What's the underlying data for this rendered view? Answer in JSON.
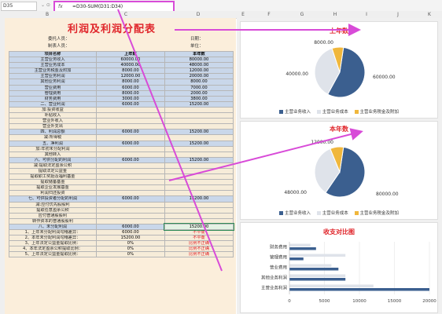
{
  "formula_bar": {
    "name_box": "D35",
    "fx_label": "fx",
    "formula": "=D30-SUM(D31:D34)"
  },
  "columns": [
    "B",
    "C",
    "D",
    "E",
    "F",
    "G",
    "H",
    "I",
    "J",
    "K"
  ],
  "sheet": {
    "title": "利润及利润分配表",
    "company_label": "委托人员：",
    "preparer_label": "制表人员：",
    "date_label": "日期：",
    "unit_label": "单位：",
    "rows": [
      {
        "item": "项目名称",
        "prev": "上年数",
        "curr": "本年数",
        "style": "hdr"
      },
      {
        "item": "主营业务收入",
        "prev": "60000.00",
        "curr": "80000.00",
        "style": "blue"
      },
      {
        "item": "主营业务成本",
        "prev": "40000.00",
        "curr": "48000.00",
        "style": "blue"
      },
      {
        "item": "主营业务税金及附加",
        "prev": "8000.00",
        "curr": "12000.00",
        "style": "blue"
      },
      {
        "item": "主营业务利润",
        "prev": "12000.00",
        "curr": "20000.00",
        "style": "blue"
      },
      {
        "item": "其他业务利润",
        "prev": "8000.00",
        "curr": "8000.00",
        "style": "blue"
      },
      {
        "item": "营业费用",
        "prev": "6000.00",
        "curr": "7000.00",
        "style": "blue"
      },
      {
        "item": "管理费用",
        "prev": "8000.00",
        "curr": "2000.00",
        "style": "blue"
      },
      {
        "item": "财务费用",
        "prev": "3000.00",
        "curr": "3800.00",
        "style": "blue"
      },
      {
        "item": "二、营业利润",
        "prev": "6000.00",
        "curr": "15200.00",
        "style": "blue"
      },
      {
        "item": "加:投资收益",
        "prev": "",
        "curr": "",
        "style": "plain"
      },
      {
        "item": "补贴收入",
        "prev": "",
        "curr": "",
        "style": "plain"
      },
      {
        "item": "营业外收入",
        "prev": "",
        "curr": "",
        "style": "plain"
      },
      {
        "item": "营业外支出",
        "prev": "",
        "curr": "",
        "style": "plain"
      },
      {
        "item": "四、利润总额",
        "prev": "6000.00",
        "curr": "15200.00",
        "style": "blue"
      },
      {
        "item": "减:所得税",
        "prev": "",
        "curr": "",
        "style": "plain"
      },
      {
        "item": "五、净利润",
        "prev": "6000.00",
        "curr": "15200.00",
        "style": "blue"
      },
      {
        "item": "加:年初未分配利润",
        "prev": "",
        "curr": "",
        "style": "plain"
      },
      {
        "item": "其他转入",
        "prev": "",
        "curr": "",
        "style": "plain"
      },
      {
        "item": "六、可供分配的利润",
        "prev": "6000.00",
        "curr": "15200.00",
        "style": "blue"
      },
      {
        "item": "减:提取法定盈余公积",
        "prev": "",
        "curr": "",
        "style": "plain"
      },
      {
        "item": "提取法定公益金",
        "prev": "",
        "curr": "",
        "style": "plain"
      },
      {
        "item": "提取职工奖励及福利基金",
        "prev": "",
        "curr": "",
        "style": "plain"
      },
      {
        "item": "提取储备基金",
        "prev": "",
        "curr": "",
        "style": "plain"
      },
      {
        "item": "提取企业发展基金",
        "prev": "",
        "curr": "",
        "style": "plain"
      },
      {
        "item": "利润归还投资",
        "prev": "",
        "curr": "",
        "style": "plain"
      },
      {
        "item": "七、可供投资者分配的利润",
        "prev": "6000.00",
        "curr": "15200.00",
        "style": "blue"
      },
      {
        "item": "减:应付优先股股利",
        "prev": "",
        "curr": "",
        "style": "plain"
      },
      {
        "item": "提取任意盈余公积",
        "prev": "",
        "curr": "",
        "style": "plain"
      },
      {
        "item": "应付普通股股利",
        "prev": "",
        "curr": "",
        "style": "plain"
      },
      {
        "item": "转作资本的普通股股利",
        "prev": "",
        "curr": "",
        "style": "plain"
      },
      {
        "item": "八、未分配利润",
        "prev": "6000.00",
        "curr": "15200.00",
        "style": "blue",
        "selected": true
      },
      {
        "item": "1、上年未分配利润勾稽差异：",
        "prev": "6000.00",
        "curr": "不平衡",
        "style": "plain",
        "red": true
      },
      {
        "item": "2、本年未分配利润勾稽差异：",
        "prev": "15200.00",
        "curr": "不平衡",
        "style": "plain",
        "red": true
      },
      {
        "item": "3、上年法定公益金提取比例：",
        "prev": "0%",
        "curr": "比例不正确",
        "style": "plain",
        "red": true
      },
      {
        "item": "4、本年法定盈余公积提取比例：",
        "prev": "0%",
        "curr": "比例不正确",
        "style": "plain",
        "red": true
      },
      {
        "item": "5、上年法定公益金提取比例：",
        "prev": "0%",
        "curr": "比例不正确",
        "style": "plain",
        "red": true
      }
    ]
  },
  "legend": {
    "revenue": "主营业务收入",
    "cost": "主营业务成本",
    "tax": "主营业务税金及附加"
  },
  "colors": {
    "revenue": "#3b5f8f",
    "cost": "#dfe3ea",
    "tax": "#f0b73c",
    "bar_prev": "#dfe3ea",
    "bar_curr": "#3b5f8f",
    "accent": "#e0262b",
    "arrow": "#d84bd8"
  },
  "chart_data": [
    {
      "type": "pie",
      "title": "上年数",
      "categories": [
        "主营业务收入",
        "主营业务成本",
        "主营业务税金及附加"
      ],
      "values": [
        60000,
        40000,
        8000
      ],
      "data_labels": [
        "60000.00",
        "40000.00",
        "8000.00"
      ],
      "legend": "bottom"
    },
    {
      "type": "pie",
      "title": "本年数",
      "categories": [
        "主营业务收入",
        "主营业务成本",
        "主营业务税金及附加"
      ],
      "values": [
        80000,
        48000,
        12000
      ],
      "data_labels": [
        "80000.00",
        "48000.00",
        "12000.00"
      ],
      "legend": "bottom"
    },
    {
      "type": "bar",
      "orientation": "horizontal",
      "title": "收支对比图",
      "categories": [
        "主营业务利润",
        "其他业务利润",
        "营业费用",
        "管理费用",
        "财务费用"
      ],
      "series": [
        {
          "values": [
            12000,
            8000,
            6000,
            8000,
            3000
          ]
        },
        {
          "values": [
            20000,
            8000,
            7000,
            2000,
            3800
          ]
        }
      ],
      "xlim": [
        0,
        20000
      ],
      "xticks": [
        "0",
        "5000",
        "10000",
        "15000",
        "20000"
      ],
      "grid": true
    }
  ]
}
